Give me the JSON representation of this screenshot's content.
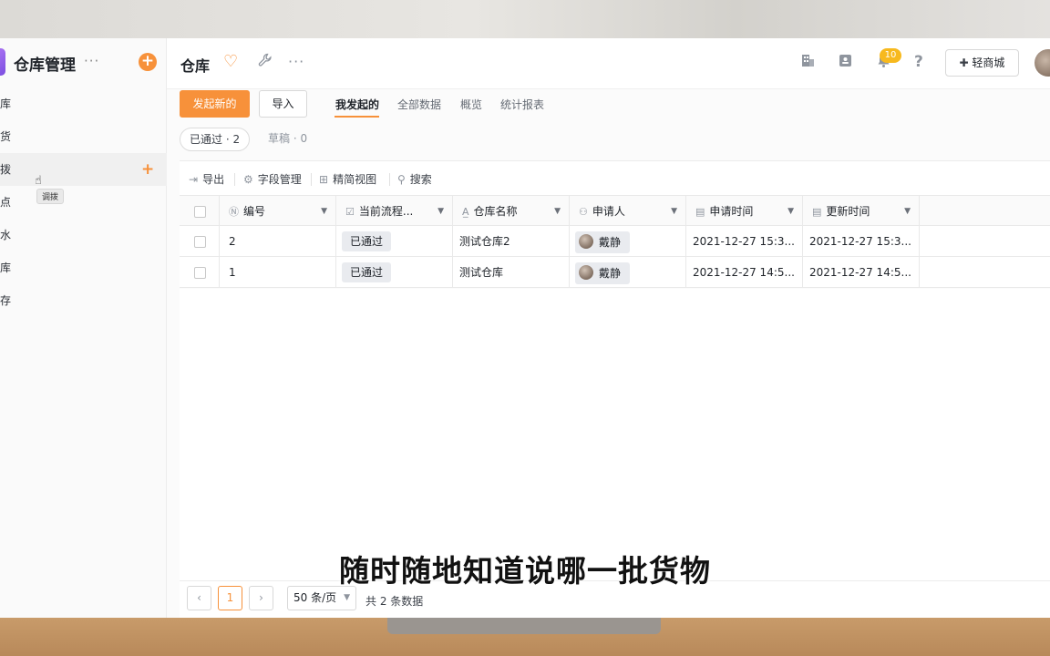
{
  "app": {
    "title": "仓库管理",
    "more": "···"
  },
  "sidebar": {
    "items": [
      {
        "label": "入库"
      },
      {
        "label": "出货"
      },
      {
        "label": "调拨",
        "add": "+"
      },
      {
        "label": "盘点"
      },
      {
        "label": "流水"
      },
      {
        "label": "仓库"
      },
      {
        "label": "库存"
      }
    ],
    "tooltip": "调拨"
  },
  "header": {
    "title": "仓库",
    "more": "···",
    "notification_count": "10",
    "help": "?",
    "shop_button": "轻商城"
  },
  "actions": {
    "primary": "发起新的",
    "import": "导入"
  },
  "tabs": [
    "我发起的",
    "全部数据",
    "概览",
    "统计报表"
  ],
  "filters": {
    "approved": "已通过 · 2",
    "draft": "草稿 · 0"
  },
  "toolbar": {
    "export": "导出",
    "fields": "字段管理",
    "compact_view": "精简视图",
    "search": "搜索"
  },
  "table": {
    "columns": [
      "编号",
      "当前流程...",
      "仓库名称",
      "申请人",
      "申请时间",
      "更新时间"
    ],
    "rows": [
      {
        "id": "2",
        "status": "已通过",
        "name": "测试仓库2",
        "applicant": "戴静",
        "applied": "2021-12-27 15:3...",
        "updated": "2021-12-27 15:3..."
      },
      {
        "id": "1",
        "status": "已通过",
        "name": "测试仓库",
        "applicant": "戴静",
        "applied": "2021-12-27 14:5...",
        "updated": "2021-12-27 14:5..."
      }
    ]
  },
  "pagination": {
    "prev": "‹",
    "current": "1",
    "next": "›",
    "page_size": "50 条/页",
    "total": "共 2 条数据"
  },
  "subtitle": "随时随地知道说哪一批货物",
  "colors": {
    "accent": "#f7913a",
    "badge": "#f7b91e"
  }
}
